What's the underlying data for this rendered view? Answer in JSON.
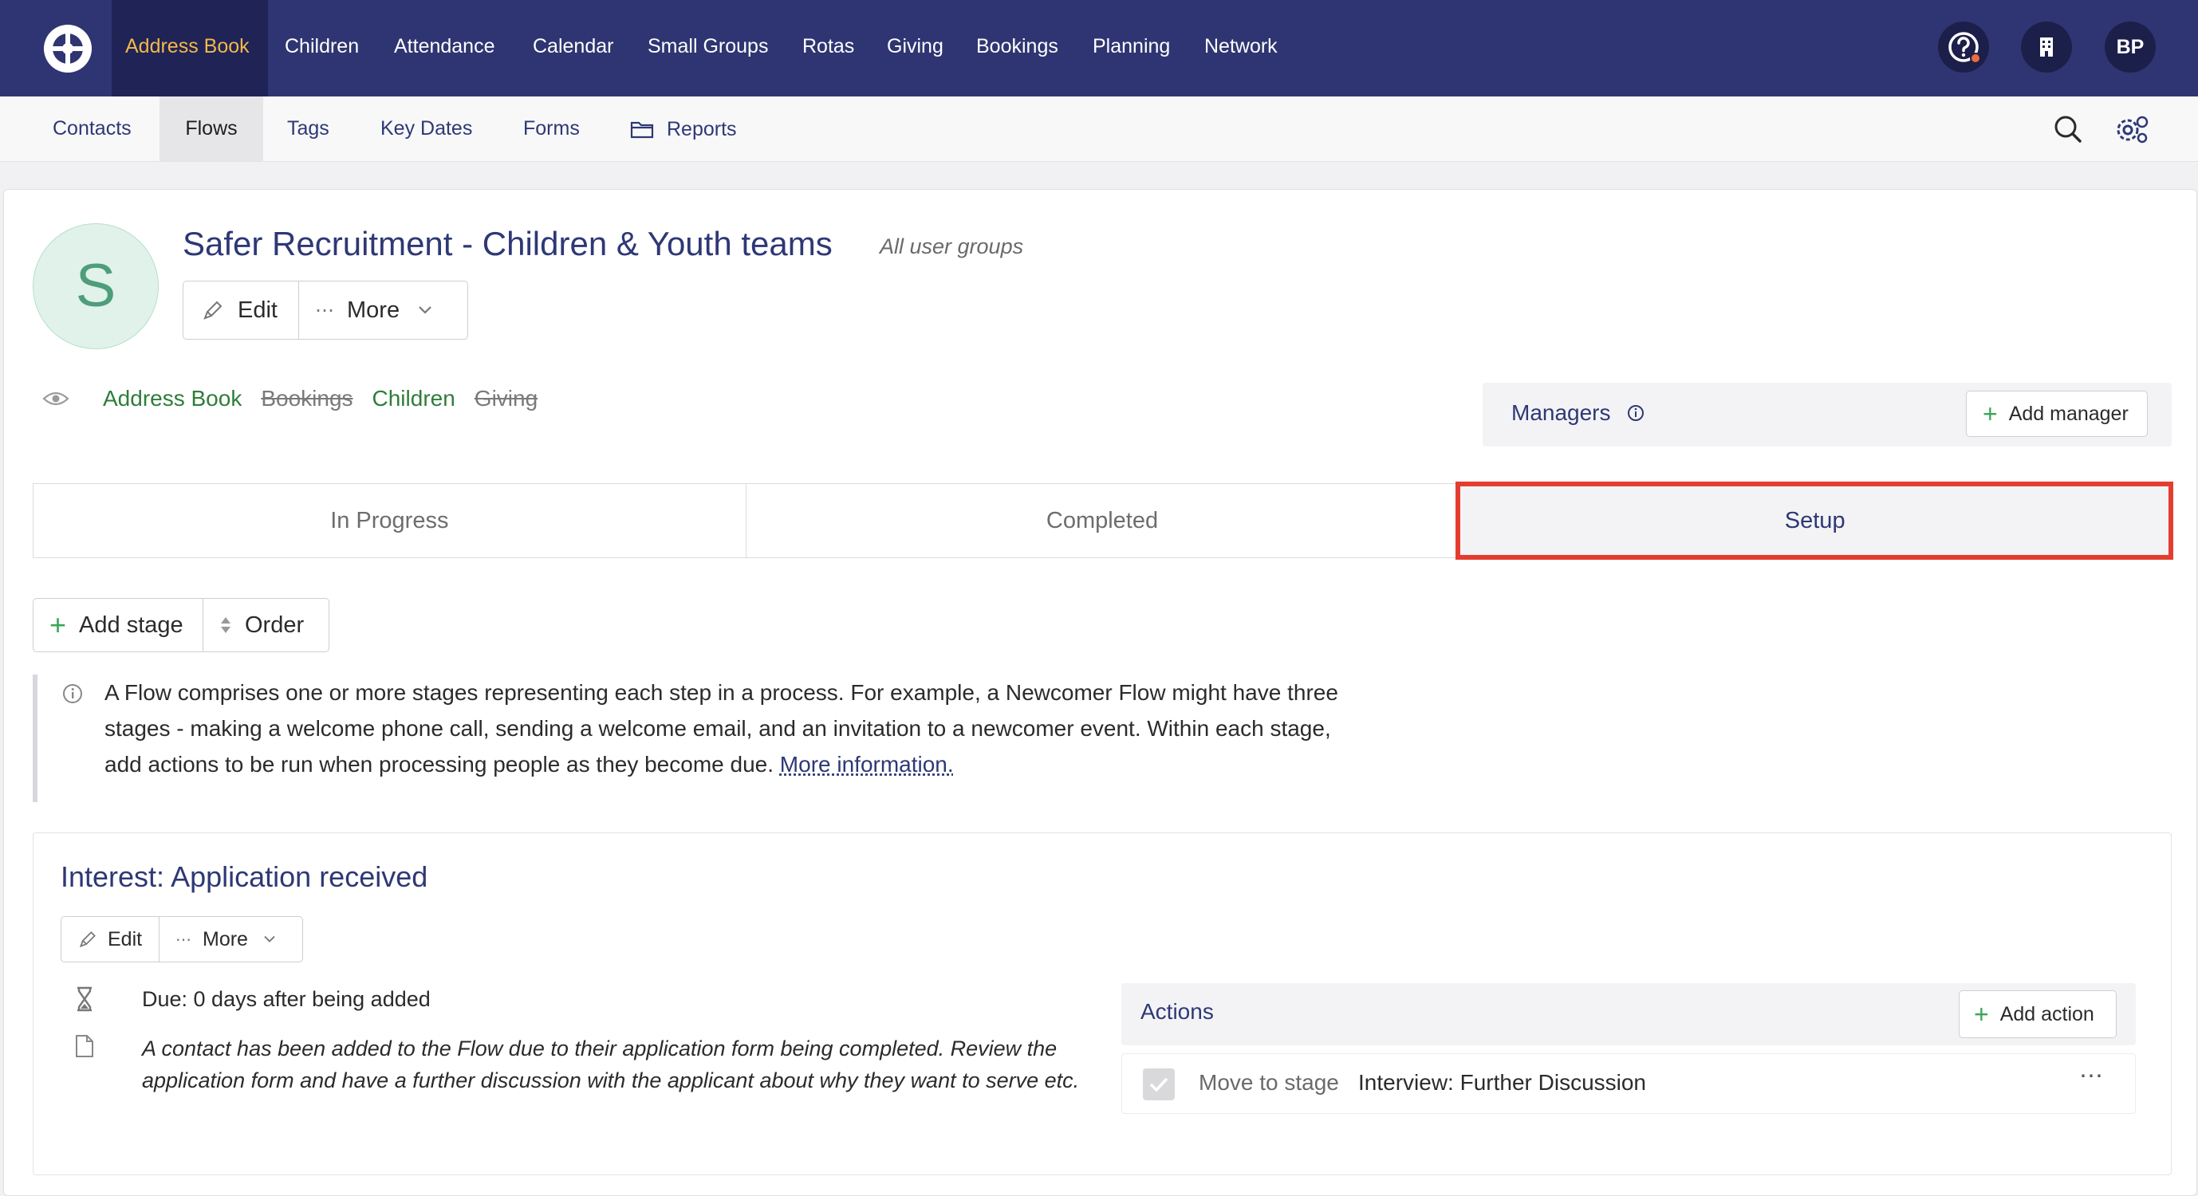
{
  "topnav": {
    "items": [
      "Address Book",
      "Children",
      "Attendance",
      "Calendar",
      "Small Groups",
      "Rotas",
      "Giving",
      "Bookings",
      "Planning",
      "Network"
    ],
    "user_initials": "BP",
    "icons": [
      "help-icon",
      "building-icon"
    ]
  },
  "subnav": {
    "items": [
      "Contacts",
      "Flows",
      "Tags",
      "Key Dates",
      "Forms",
      "Reports"
    ]
  },
  "flow": {
    "avatar_letter": "S",
    "title": "Safer Recruitment - Children & Youth teams",
    "scope": "All user groups",
    "edit_label": "Edit",
    "more_label": "More"
  },
  "visibility": {
    "modules": [
      {
        "label": "Address Book",
        "enabled": true
      },
      {
        "label": "Bookings",
        "enabled": false
      },
      {
        "label": "Children",
        "enabled": true
      },
      {
        "label": "Giving",
        "enabled": false
      }
    ]
  },
  "managers": {
    "label": "Managers",
    "add_label": "Add manager"
  },
  "tabs": [
    "In Progress",
    "Completed",
    "Setup"
  ],
  "toolbar": {
    "add_stage_label": "Add stage",
    "order_label": "Order"
  },
  "info": {
    "text": "A Flow comprises one or more stages representing each step in a process. For example, a Newcomer Flow might have three stages - making a welcome phone call, sending a welcome email, and an invitation to a newcomer event. Within each stage, add actions to be run when processing people as they become due.",
    "link": "More information."
  },
  "stage": {
    "title": "Interest: Application received",
    "edit_label": "Edit",
    "more_label": "More",
    "due": "Due: 0 days after being added",
    "description": "A contact has been added to the Flow due to their application form being completed. Review the application form and have a further discussion with the applicant about why they want to serve etc.",
    "actions_label": "Actions",
    "add_action_label": "Add action",
    "action": {
      "label": "Move to stage",
      "target": "Interview: Further Discussion"
    }
  },
  "colors": {
    "nav_bg": "#2f3572",
    "nav_active_text": "#f2b84a",
    "highlight": "#e43d2f",
    "link": "#2e3875",
    "enabled_module": "#2f7d3a"
  }
}
